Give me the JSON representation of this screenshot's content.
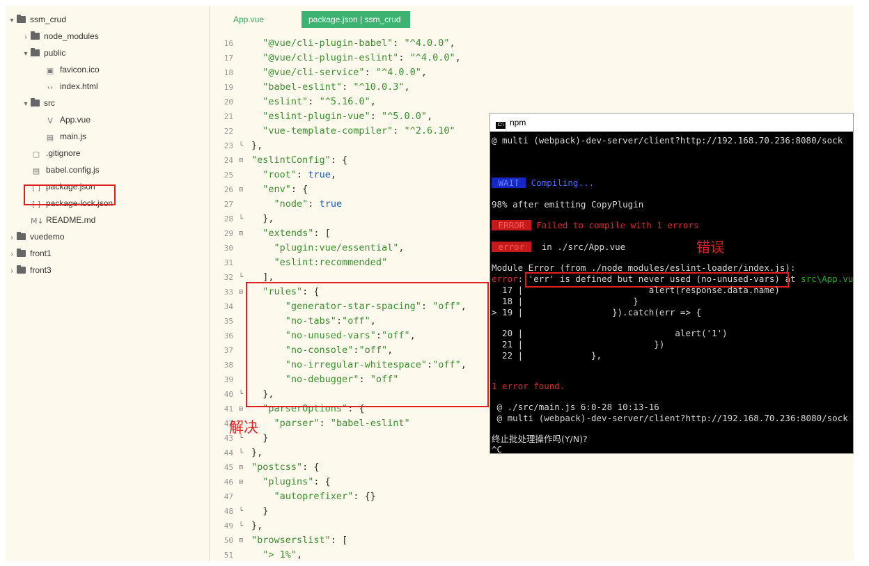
{
  "sidebar": {
    "items": [
      {
        "label": "ssm_crud",
        "chevron": "▾",
        "icon": "folder-icon"
      },
      {
        "label": "node_modules",
        "chevron": "›",
        "icon": "folder-icon"
      },
      {
        "label": "public",
        "chevron": "▾",
        "icon": "folder-open-icon"
      },
      {
        "label": "favicon.ico",
        "chevron": "",
        "icon": "image-file-icon"
      },
      {
        "label": "index.html",
        "chevron": "",
        "icon": "html-file-icon"
      },
      {
        "label": "src",
        "chevron": "▾",
        "icon": "folder-open-icon"
      },
      {
        "label": "App.vue",
        "chevron": "",
        "icon": "vue-file-icon"
      },
      {
        "label": "main.js",
        "chevron": "",
        "icon": "js-file-icon"
      },
      {
        "label": ".gitignore",
        "chevron": "",
        "icon": "file-icon"
      },
      {
        "label": "babel.config.js",
        "chevron": "",
        "icon": "js-file-icon"
      },
      {
        "label": "package.json",
        "chevron": "",
        "icon": "json-file-icon"
      },
      {
        "label": "package-lock.json",
        "chevron": "",
        "icon": "json-file-icon"
      },
      {
        "label": "README.md",
        "chevron": "",
        "icon": "markdown-file-icon"
      },
      {
        "label": "vuedemo",
        "chevron": "›",
        "icon": "folder-icon"
      },
      {
        "label": "front1",
        "chevron": "›",
        "icon": "folder-icon"
      },
      {
        "label": "front3",
        "chevron": "›",
        "icon": "folder-icon"
      }
    ]
  },
  "tabs": {
    "app": "App.vue",
    "active": "package.json | ssm_crud"
  },
  "editor": {
    "lines": [
      {
        "n": "16",
        "fold": "",
        "code": "  \"@vue/cli-plugin-babel\": \"^4.0.0\","
      },
      {
        "n": "17",
        "fold": "",
        "code": "  \"@vue/cli-plugin-eslint\": \"^4.0.0\","
      },
      {
        "n": "18",
        "fold": "",
        "code": "  \"@vue/cli-service\": \"^4.0.0\","
      },
      {
        "n": "19",
        "fold": "",
        "code": "  \"babel-eslint\": \"^10.0.3\","
      },
      {
        "n": "20",
        "fold": "",
        "code": "  \"eslint\": \"^5.16.0\","
      },
      {
        "n": "21",
        "fold": "",
        "code": "  \"eslint-plugin-vue\": \"^5.0.0\","
      },
      {
        "n": "22",
        "fold": "",
        "code": "  \"vue-template-compiler\": \"^2.6.10\""
      },
      {
        "n": "23",
        "fold": "└",
        "code": "},"
      },
      {
        "n": "24",
        "fold": "⊟",
        "code": "\"eslintConfig\": {"
      },
      {
        "n": "25",
        "fold": "",
        "code": "  \"root\": true,"
      },
      {
        "n": "26",
        "fold": "⊟",
        "code": "  \"env\": {"
      },
      {
        "n": "27",
        "fold": "",
        "code": "    \"node\": true"
      },
      {
        "n": "28",
        "fold": "└",
        "code": "  },"
      },
      {
        "n": "29",
        "fold": "⊟",
        "code": "  \"extends\": ["
      },
      {
        "n": "30",
        "fold": "",
        "code": "    \"plugin:vue/essential\","
      },
      {
        "n": "31",
        "fold": "",
        "code": "    \"eslint:recommended\""
      },
      {
        "n": "32",
        "fold": "└",
        "code": "  ],"
      },
      {
        "n": "33",
        "fold": "⊟",
        "code": "  \"rules\": {"
      },
      {
        "n": "34",
        "fold": "",
        "code": "      \"generator-star-spacing\": \"off\","
      },
      {
        "n": "35",
        "fold": "",
        "code": "      \"no-tabs\":\"off\","
      },
      {
        "n": "36",
        "fold": "",
        "code": "      \"no-unused-vars\":\"off\","
      },
      {
        "n": "37",
        "fold": "",
        "code": "      \"no-console\":\"off\","
      },
      {
        "n": "38",
        "fold": "",
        "code": "      \"no-irregular-whitespace\":\"off\","
      },
      {
        "n": "39",
        "fold": "",
        "code": "      \"no-debugger\": \"off\""
      },
      {
        "n": "40",
        "fold": "└",
        "code": "  },"
      },
      {
        "n": "41",
        "fold": "⊟",
        "code": "  \"parserOptions\": {"
      },
      {
        "n": "42",
        "fold": "",
        "code": "    \"parser\": \"babel-eslint\""
      },
      {
        "n": "43",
        "fold": "└",
        "code": "  }"
      },
      {
        "n": "44",
        "fold": "└",
        "code": "},"
      },
      {
        "n": "45",
        "fold": "⊟",
        "code": "\"postcss\": {"
      },
      {
        "n": "46",
        "fold": "⊟",
        "code": "  \"plugins\": {"
      },
      {
        "n": "47",
        "fold": "",
        "code": "    \"autoprefixer\": {}"
      },
      {
        "n": "48",
        "fold": "└",
        "code": "  }"
      },
      {
        "n": "49",
        "fold": "└",
        "code": "},"
      },
      {
        "n": "50",
        "fold": "⊟",
        "code": "\"browserslist\": ["
      },
      {
        "n": "51",
        "fold": "",
        "code": "  \"> 1%\","
      }
    ]
  },
  "terminal": {
    "title": "npm",
    "line1": "@ multi (webpack)-dev-server/client?http://192.168.70.236:8080/sock",
    "wait_badge": " WAIT ",
    "compiling": " Compiling...",
    "emitting": "98% after emitting CopyPlugin",
    "error_badge": " ERROR ",
    "failed": " Failed to compile with 1 errors",
    "error_badge2": " error ",
    "in_file": "  in ./src/App.vue",
    "module_error": "Module Error (from ./node_modules/eslint-loader/index.js):",
    "error_label": "error",
    "error_colon": ": ",
    "error_msg": "'err' is defined but never used (no-unused-vars)",
    "error_at": " at ",
    "error_loc": "src\\App.vue",
    "code17": "  17 |                        alert(response.data.name)",
    "code18": "  18 |                     }",
    "code19": "> 19 |                 }).catch(err => {",
    "code20": "  20 |                             alert('1')",
    "code21": "  21 |                         })",
    "code22": "  22 |             },",
    "found": "1 error found.",
    "main_js": " @ ./src/main.js 6:0-28 10:13-16",
    "line_multi": " @ multi (webpack)-dev-server/client?http://192.168.70.236:8080/sock",
    "prompt": "终止批处理操作吗(Y/N)?",
    "ctrl_c": "^C"
  },
  "annotations": {
    "error": "错误",
    "solution": "解决"
  }
}
